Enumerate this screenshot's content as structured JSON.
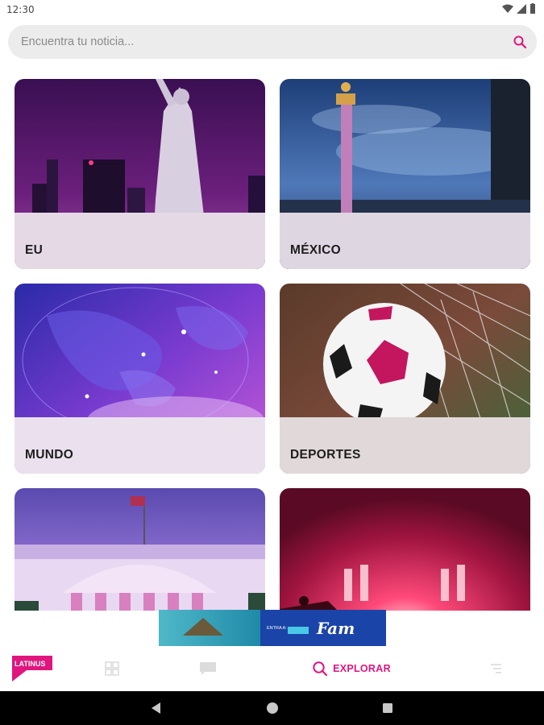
{
  "status": {
    "time": "12:30"
  },
  "search": {
    "placeholder": "Encuentra tu noticia..."
  },
  "categories": [
    {
      "label": "EU"
    },
    {
      "label": "MÉXICO"
    },
    {
      "label": "MUNDO"
    },
    {
      "label": "DEPORTES"
    },
    {
      "label": ""
    },
    {
      "label": ""
    }
  ],
  "logo": {
    "text": "LATINUS"
  },
  "nav": {
    "explore_label": "EXPLORAR"
  },
  "banner": {
    "text_small": "ENTRA A:",
    "brand": "Fam"
  },
  "colors": {
    "accent": "#e0157e",
    "search_bg": "#ececec"
  }
}
